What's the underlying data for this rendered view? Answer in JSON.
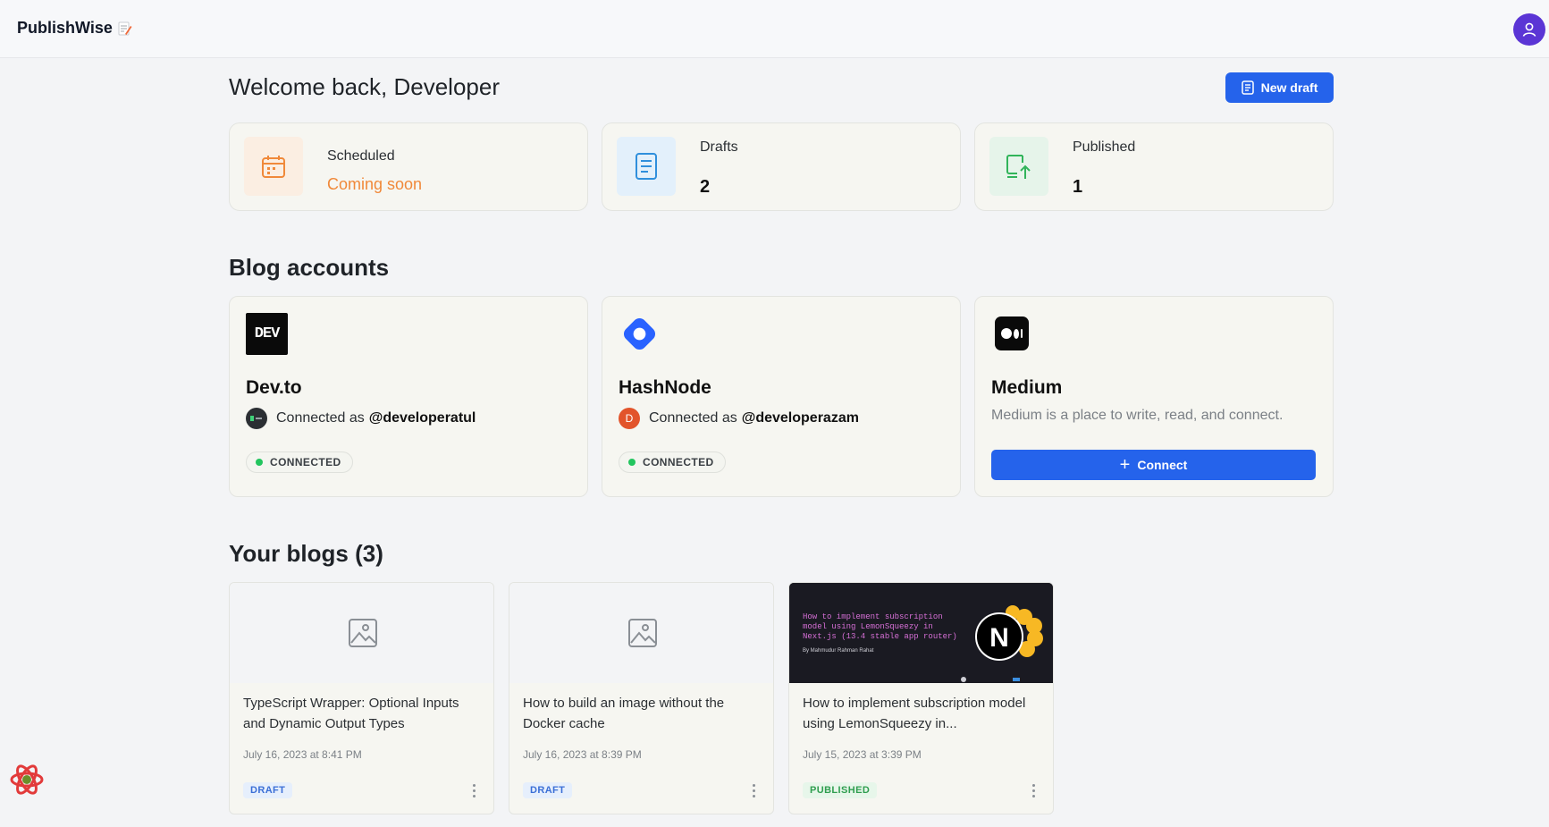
{
  "topbar": {
    "brand": "PublishWise",
    "brand_icon": "memo-icon",
    "user_icon": "user-icon"
  },
  "header": {
    "welcome": "Welcome back, Developer",
    "new_draft_label": "New draft"
  },
  "stats": [
    {
      "label": "Scheduled",
      "value": "Coming soon",
      "icon": "calendar-icon",
      "color": "#f0893a"
    },
    {
      "label": "Drafts",
      "value": "2",
      "icon": "document-icon",
      "color": "#2f8fdc"
    },
    {
      "label": "Published",
      "value": "1",
      "icon": "publish-icon",
      "color": "#31b45a"
    }
  ],
  "accounts_section": {
    "title": "Blog accounts",
    "accounts": [
      {
        "name": "Dev.to",
        "logo_text": "DEV",
        "connected_prefix": "Connected as",
        "handle": "@developeratul",
        "status": "CONNECTED"
      },
      {
        "name": "HashNode",
        "connected_prefix": "Connected as",
        "handle": "@developerazam",
        "avatar_letter": "D",
        "status": "CONNECTED"
      },
      {
        "name": "Medium",
        "description": "Medium is a place to write, read, and connect.",
        "connect_label": "Connect"
      }
    ]
  },
  "blogs_section": {
    "title": "Your blogs (3)",
    "blogs": [
      {
        "title": "TypeScript Wrapper: Optional Inputs and Dynamic Output Types",
        "date": "July 16, 2023 at 8:41 PM",
        "status": "DRAFT"
      },
      {
        "title": "How to build an image without the Docker cache",
        "date": "July 16, 2023 at 8:39 PM",
        "status": "DRAFT"
      },
      {
        "title": "How to implement subscription model using LemonSqueezy in...",
        "date": "July 15, 2023 at 3:39 PM",
        "status": "PUBLISHED",
        "thumb_lines": [
          "How to implement subscription",
          "model using LemonSqueezy in",
          "Next.js (13.4 stable app router)"
        ],
        "thumb_byline": "By Mahmudur Rahman Rahat"
      }
    ]
  },
  "colors": {
    "accent": "#2563eb",
    "connected_dot": "#22c55e",
    "avatar": "#5b35d5"
  }
}
